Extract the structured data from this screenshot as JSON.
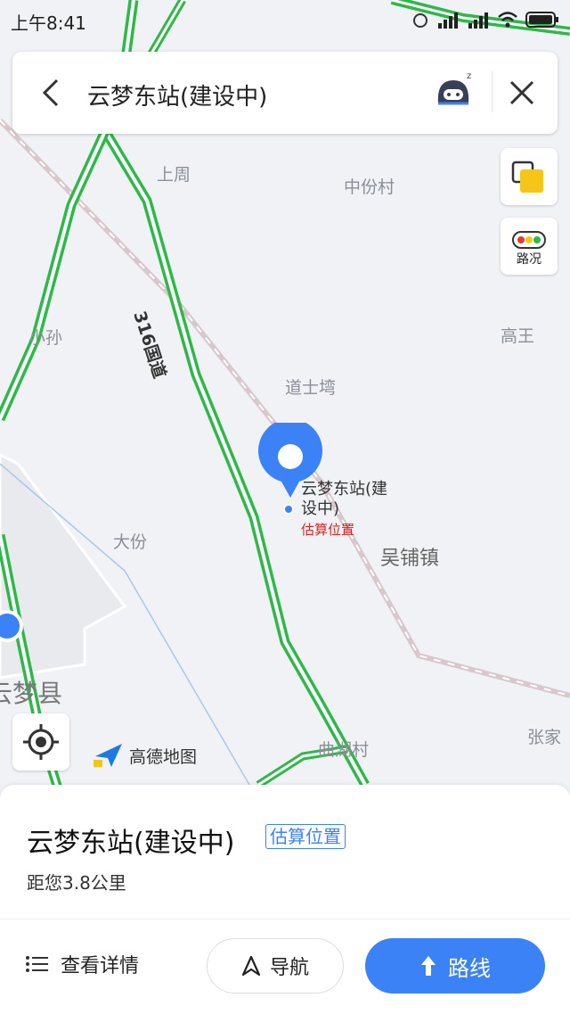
{
  "status_bar": {
    "time": "上午8:41"
  },
  "search_bar": {
    "title": "云梦东站(建设中)"
  },
  "map": {
    "road_name": "316国道",
    "place_labels": {
      "shangzhou": "上周",
      "zhongfencun": "中份村",
      "xiaosun": "小孙",
      "gaowang": "高王",
      "daoshiwan": "道士塆",
      "dafen": "大份",
      "wupuzhen": "吴铺镇",
      "yunmengxian": "云梦县",
      "quhucun": "曲湖村",
      "zhangjia": "张家"
    },
    "traffic_label": "路况",
    "pin_name": "云梦东站(建设中)",
    "pin_estimate": "估算位置",
    "brand": "高德地图"
  },
  "panel": {
    "title": "云梦东站(建设中)",
    "estimate_badge": "估算位置",
    "distance": "距您3.8公里",
    "details_label": "查看详情",
    "nav_label": "导航",
    "route_label": "路线"
  },
  "colors": {
    "accent": "#3b82f6",
    "road_green": "#2fb84a"
  }
}
